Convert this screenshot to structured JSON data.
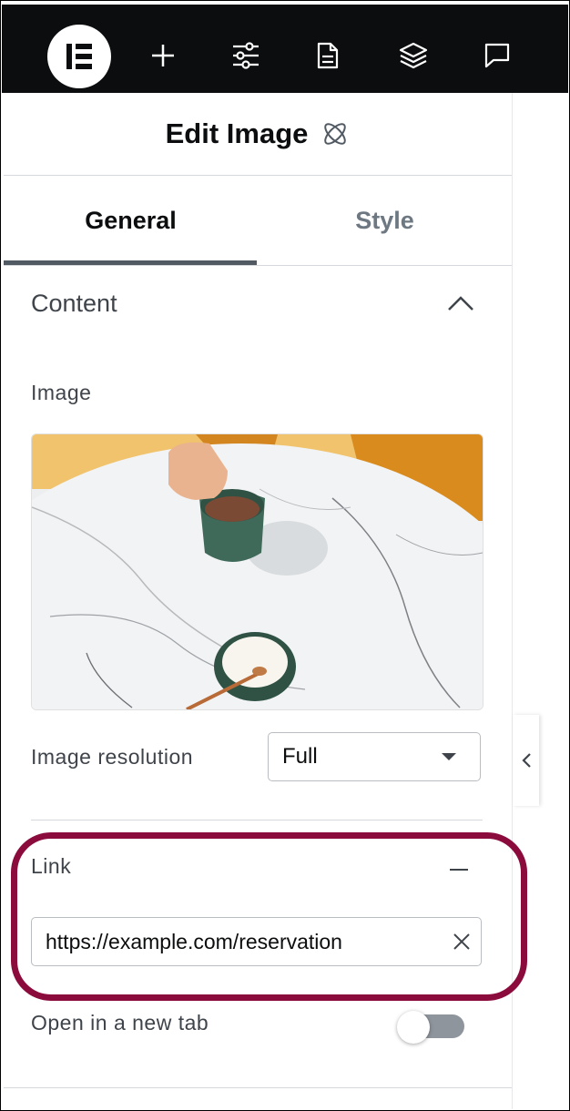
{
  "topbar": {
    "icons": [
      "elementor-logo-icon",
      "add-icon",
      "settings-sliders-icon",
      "page-icon",
      "layers-icon",
      "chat-icon"
    ]
  },
  "panel": {
    "title": "Edit Image",
    "tabs": [
      {
        "label": "General",
        "active": true
      },
      {
        "label": "Style",
        "active": false
      }
    ]
  },
  "content": {
    "section_title": "Content",
    "image_label": "Image",
    "image_resolution_label": "Image resolution",
    "image_resolution_value": "Full",
    "link_label": "Link",
    "link_value": "https://example.com/reservation",
    "new_tab_label": "Open in a new tab",
    "new_tab_enabled": false
  },
  "colors": {
    "topbar_bg": "#0c0d0e",
    "highlight": "#8b0b3d",
    "text": "#3f444b"
  }
}
